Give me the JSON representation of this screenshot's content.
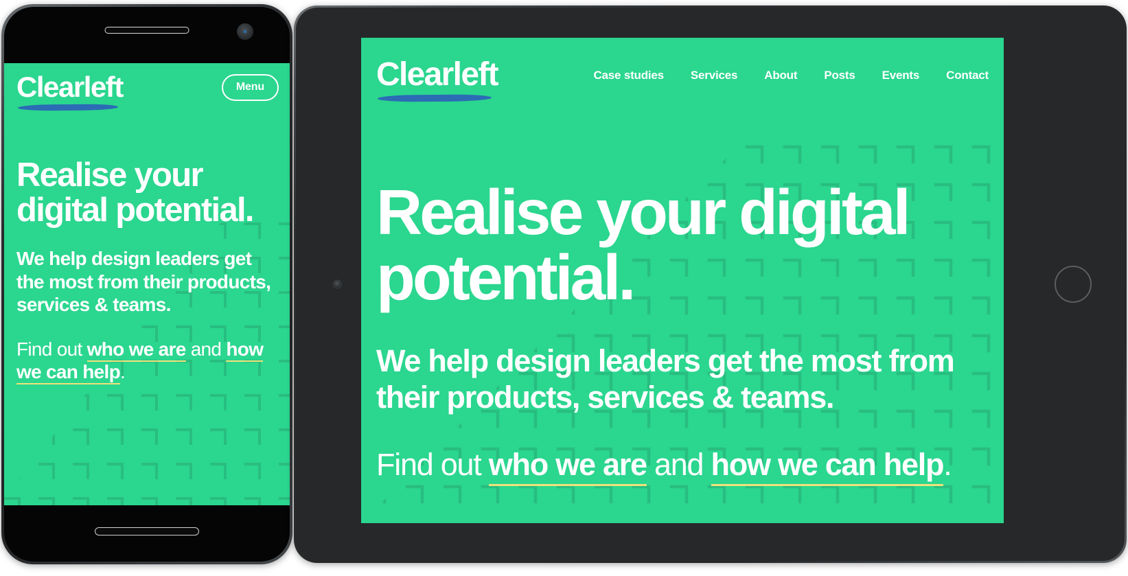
{
  "brand": {
    "name": "Clearleft",
    "logo_underline_color": "#2B6CB5"
  },
  "theme": {
    "screen_background": "#2BD68F",
    "pattern_color": "#28BE80",
    "text_color": "#FFFFFF",
    "link_underline_color": "#EFE27A",
    "device_frame_color": "#2B2D2F"
  },
  "phone": {
    "device": "smartphone",
    "menu_button_label": "Menu",
    "headline": "Realise your digital potential.",
    "lede": "We help design leaders get the most from their products, services & teams.",
    "find_out": {
      "prefix": "Find out ",
      "link_one": "who we are",
      "middle": " and ",
      "link_two": "how we can help",
      "suffix": "."
    }
  },
  "tablet": {
    "device": "tablet",
    "nav": [
      {
        "label": "Case studies"
      },
      {
        "label": "Services"
      },
      {
        "label": "About"
      },
      {
        "label": "Posts"
      },
      {
        "label": "Events"
      },
      {
        "label": "Contact"
      }
    ],
    "headline": "Realise your digital potential.",
    "lede": "We help design leaders get the most from their products, services & teams.",
    "find_out": {
      "prefix": "Find out ",
      "link_one": "who we are",
      "middle": " and ",
      "link_two": "how we can help",
      "suffix": "."
    }
  }
}
